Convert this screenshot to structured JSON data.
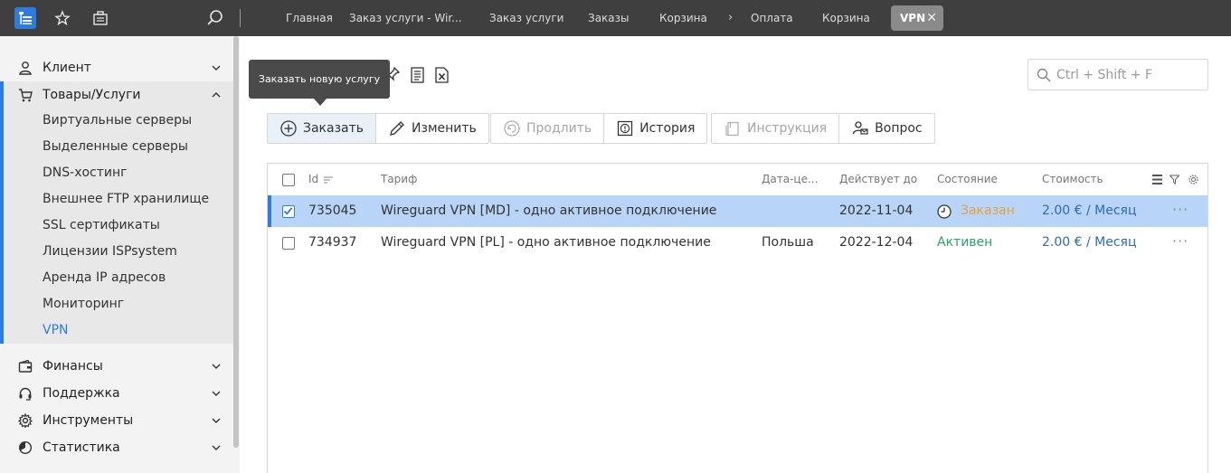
{
  "topbar": {
    "icons": [
      "app-menu-icon",
      "star-icon",
      "briefcase-icon",
      "search-icon"
    ],
    "breadcrumbs": [
      {
        "label": "Главная"
      },
      {
        "label": "Заказ услуги - Wir..."
      },
      {
        "label": "Заказ услуги"
      },
      {
        "label": "Заказы"
      },
      {
        "label": "Корзина"
      },
      {
        "label": "Оплата"
      },
      {
        "label": "Корзина"
      }
    ],
    "active_tab": "VPN",
    "close_symbol": "✕"
  },
  "sidebar": {
    "groups": [
      {
        "label": "Клиент",
        "icon": "user-icon"
      },
      {
        "label": "Товары/Услуги",
        "icon": "cart-icon",
        "expanded": true
      },
      {
        "label": "Финансы",
        "icon": "wallet-icon"
      },
      {
        "label": "Поддержка",
        "icon": "headset-icon"
      },
      {
        "label": "Инструменты",
        "icon": "gear-icon"
      },
      {
        "label": "Статистика",
        "icon": "pie-chart-icon"
      }
    ],
    "items": [
      {
        "label": "Виртуальные серверы"
      },
      {
        "label": "Выделенные серверы"
      },
      {
        "label": "DNS-хостинг"
      },
      {
        "label": "Внешнее FTP хранилище"
      },
      {
        "label": "SSL сертификаты"
      },
      {
        "label": "Лицензии ISPsystem"
      },
      {
        "label": "Аренда IP адресов"
      },
      {
        "label": "Мониторинг"
      },
      {
        "label": "VPN",
        "active": true
      }
    ]
  },
  "tooltip": "Заказать новую услугу",
  "search": {
    "placeholder": "Ctrl + Shift + F"
  },
  "toolbar": {
    "order": "Заказать",
    "edit": "Изменить",
    "renew": "Продлить",
    "history": "История",
    "instruction": "Инструкция",
    "question": "Вопрос"
  },
  "table": {
    "headers": {
      "id": "Id",
      "tariff": "Тариф",
      "datacenter": "Дата-це...",
      "valid_until": "Действует до",
      "status": "Состояние",
      "cost": "Стоимость"
    },
    "rows": [
      {
        "id": "735045",
        "tariff": "Wireguard VPN [MD] - одно активное подключение",
        "datacenter": "",
        "valid_until": "2022-11-04",
        "status": "Заказан",
        "cost": "2.00 € / Месяц",
        "selected": true
      },
      {
        "id": "734937",
        "tariff": "Wireguard VPN [PL] - одно активное подключение",
        "datacenter": "Польша",
        "valid_until": "2022-12-04",
        "status": "Активен",
        "cost": "2.00 € / Месяц",
        "selected": false
      }
    ],
    "row_menu": "···"
  },
  "colors": {
    "accent": "#2d7ce0",
    "topbar": "#3f3f3f",
    "selected_row": "#b8d4f6",
    "status_ordered": "#e8a03c",
    "status_active": "#2aa36a",
    "price": "#2d6bb5"
  }
}
